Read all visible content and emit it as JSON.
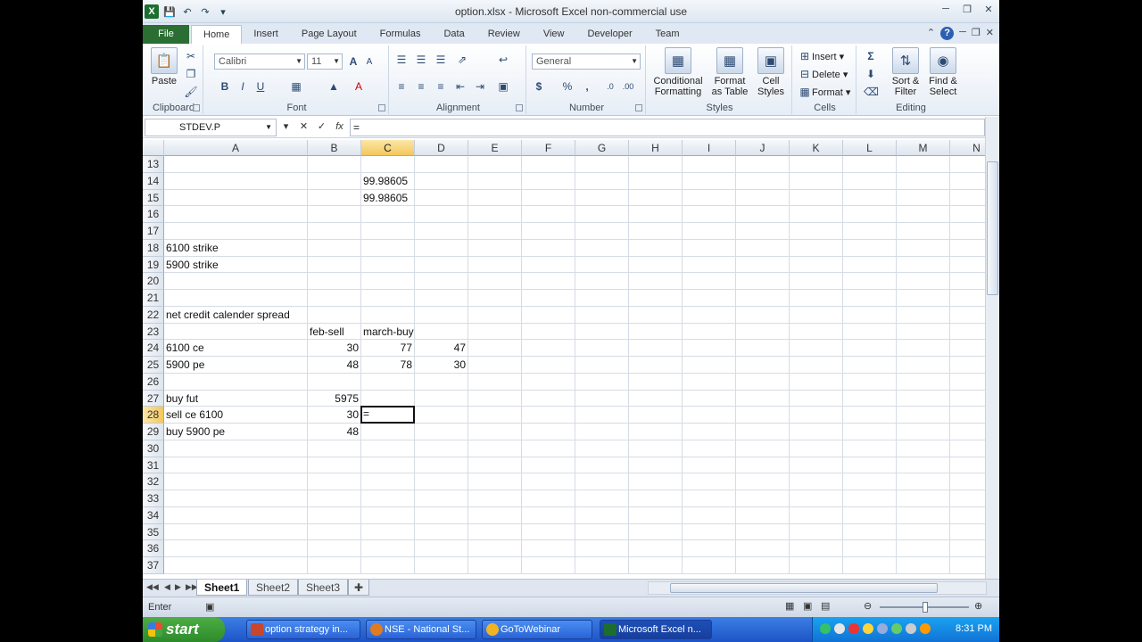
{
  "window": {
    "title": "option.xlsx - Microsoft Excel non-commercial use"
  },
  "tabs": [
    "File",
    "Home",
    "Insert",
    "Page Layout",
    "Formulas",
    "Data",
    "Review",
    "View",
    "Developer",
    "Team"
  ],
  "ribbon": {
    "clipboard": {
      "paste": "Paste",
      "label": "Clipboard"
    },
    "font": {
      "name": "Calibri",
      "size": "11",
      "label": "Font",
      "bold": "B",
      "italic": "I",
      "underline": "U"
    },
    "alignment": {
      "label": "Alignment"
    },
    "number": {
      "format": "General",
      "label": "Number",
      "currency": "$",
      "percent": "%",
      "comma": ","
    },
    "styles": {
      "conditional": "Conditional Formatting",
      "format_table": "Format as Table",
      "cell_styles": "Cell Styles",
      "label": "Styles"
    },
    "cells": {
      "insert": "Insert",
      "delete": "Delete",
      "format": "Format",
      "label": "Cells"
    },
    "editing": {
      "sort": "Sort & Filter",
      "find": "Find & Select",
      "label": "Editing"
    }
  },
  "formula_bar": {
    "name_box": "STDEV.P",
    "fx": "fx",
    "content": "="
  },
  "columns": [
    "A",
    "B",
    "C",
    "D",
    "E",
    "F",
    "G",
    "H",
    "I",
    "J",
    "K",
    "L",
    "M",
    "N"
  ],
  "rows": [
    "13",
    "14",
    "15",
    "16",
    "17",
    "18",
    "19",
    "20",
    "21",
    "22",
    "23",
    "24",
    "25",
    "26",
    "27",
    "28",
    "29",
    "30",
    "31",
    "32",
    "33",
    "34",
    "35",
    "36",
    "37"
  ],
  "cells": [
    {
      "col": "C",
      "row": "14",
      "value": "99.98605",
      "align": "left"
    },
    {
      "col": "C",
      "row": "15",
      "value": "99.98605",
      "align": "left"
    },
    {
      "col": "A",
      "row": "18",
      "value": "6100 strike",
      "align": "left"
    },
    {
      "col": "A",
      "row": "19",
      "value": "5900 strike",
      "align": "left"
    },
    {
      "col": "A",
      "row": "22",
      "value": "net credit calender spread",
      "align": "left"
    },
    {
      "col": "B",
      "row": "23",
      "value": "feb-sell",
      "align": "left"
    },
    {
      "col": "C",
      "row": "23",
      "value": "march-buy",
      "align": "left"
    },
    {
      "col": "A",
      "row": "24",
      "value": "6100 ce",
      "align": "left"
    },
    {
      "col": "B",
      "row": "24",
      "value": "30",
      "align": "right"
    },
    {
      "col": "C",
      "row": "24",
      "value": "77",
      "align": "right"
    },
    {
      "col": "D",
      "row": "24",
      "value": "47",
      "align": "right"
    },
    {
      "col": "A",
      "row": "25",
      "value": "5900 pe",
      "align": "left"
    },
    {
      "col": "B",
      "row": "25",
      "value": "48",
      "align": "right"
    },
    {
      "col": "C",
      "row": "25",
      "value": "78",
      "align": "right"
    },
    {
      "col": "D",
      "row": "25",
      "value": "30",
      "align": "right"
    },
    {
      "col": "A",
      "row": "27",
      "value": "buy fut",
      "align": "left"
    },
    {
      "col": "B",
      "row": "27",
      "value": "5975",
      "align": "right"
    },
    {
      "col": "A",
      "row": "28",
      "value": "sell ce 6100",
      "align": "left"
    },
    {
      "col": "B",
      "row": "28",
      "value": "30",
      "align": "right"
    },
    {
      "col": "A",
      "row": "29",
      "value": "buy 5900 pe",
      "align": "left"
    },
    {
      "col": "B",
      "row": "29",
      "value": "48",
      "align": "right"
    }
  ],
  "active_cell": {
    "col": "C",
    "row": "28",
    "value": "="
  },
  "sheets": [
    "Sheet1",
    "Sheet2",
    "Sheet3"
  ],
  "status": {
    "mode": "Enter"
  },
  "taskbar": {
    "start": "start",
    "items": [
      "option strategy in...",
      "NSE - National St...",
      "GoToWebinar",
      "Microsoft Excel n..."
    ],
    "clock": "8:31 PM"
  },
  "colors": {
    "excel_green": "#2a6e33",
    "selection_header": "#f2c75d",
    "taskbar_blue": "#2a63d6"
  }
}
